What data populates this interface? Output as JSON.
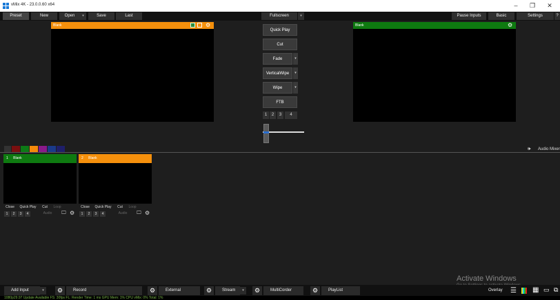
{
  "window": {
    "title": "vMix 4K - 23.0.0.60 x64",
    "minimize": "–",
    "maximize": "❐",
    "close": "✕"
  },
  "toolbar": {
    "preset": "Preset",
    "new": "New",
    "open": "Open",
    "save": "Save",
    "last": "Last",
    "fullscreen": "Fullscreen",
    "pause_inputs": "Pause Inputs",
    "basic": "Basic",
    "settings": "Settings",
    "help": "?",
    "drop_glyph": "▾"
  },
  "preview": {
    "title": "Blank",
    "header_color": "#f5900c"
  },
  "output": {
    "title": "Blank",
    "header_color": "#0e7a10"
  },
  "transitions": {
    "quick_play": "Quick Play",
    "cut": "Cut",
    "fade": "Fade",
    "vertical_wipe": "VerticalWipe",
    "wipe": "Wipe",
    "ftb": "FTB",
    "numbers": [
      "1",
      "2",
      "3",
      "4"
    ],
    "drop_glyph": "▾"
  },
  "color_swatches": [
    "#7a0f0f",
    "#0d7a16",
    "#f58a0a",
    "#8a1a8a",
    "#1a3a8a",
    "#1f1f6a"
  ],
  "audio_mixer": {
    "label": "Audio Mixer",
    "icon": "speaker-icon"
  },
  "inputs": [
    {
      "number": "1",
      "name": "Blank",
      "header_color": "#0e7a10",
      "close": "Close",
      "quick_play": "Quick Play",
      "cut": "Cut",
      "loop": "Loop",
      "audio": "Audio",
      "nums": [
        "1",
        "2",
        "3",
        "4"
      ]
    },
    {
      "number": "2",
      "name": "Blank",
      "header_color": "#f5900c",
      "close": "Close",
      "quick_play": "Quick Play",
      "cut": "Cut",
      "loop": "Loop",
      "audio": "Audio",
      "nums": [
        "1",
        "2",
        "3",
        "4"
      ]
    }
  ],
  "bottom": {
    "add_input": "Add Input",
    "record": "Record",
    "external": "External",
    "stream": "Stream",
    "multicorder": "MultiCorder",
    "playlist": "PlayList",
    "overlay": "Overlay",
    "drop_glyph": "▾"
  },
  "status": {
    "text": "1080p29.97   Update Available   FS: 30fps   FL: Render Time: 1 ms   GPU Mem: 1%   CPU vMix: 0%   Total: 1%"
  },
  "watermark": {
    "line1": "Activate Windows",
    "line2": "Go to Settings to activate Windows."
  }
}
